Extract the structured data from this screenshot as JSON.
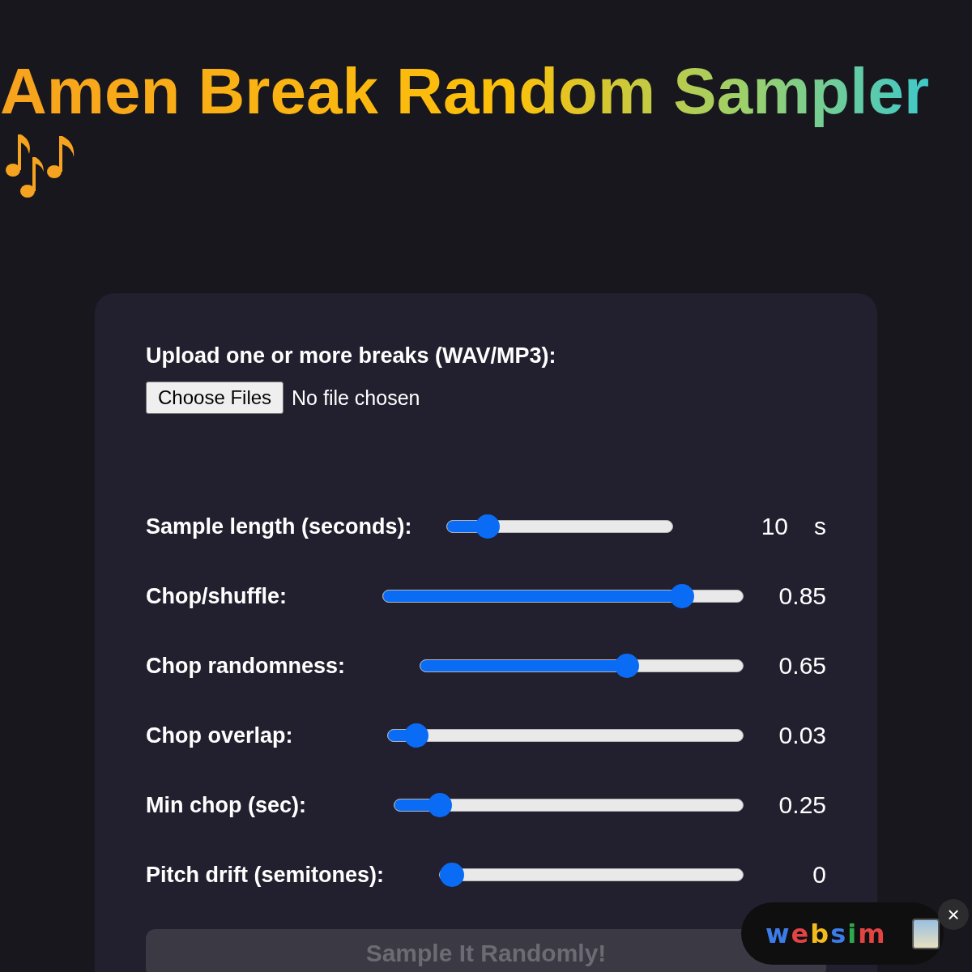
{
  "title": "Amen Break Random Sampler",
  "upload": {
    "label": "Upload one or more breaks (WAV/MP3):",
    "button": "Choose Files",
    "status": "No file chosen"
  },
  "sliders": [
    {
      "label": "Sample length (seconds):",
      "level": 0.18,
      "reading": "10",
      "unit": "s"
    },
    {
      "label": "Chop/shuffle:",
      "level": 0.83,
      "reading": "0.85"
    },
    {
      "label": "Chop randomness:",
      "level": 0.64,
      "reading": "0.65"
    },
    {
      "label": "Chop overlap:",
      "level": 0.08,
      "reading": "0.03"
    },
    {
      "label": "Min chop (sec):",
      "level": 0.13,
      "reading": "0.25"
    },
    {
      "label": "Pitch drift (semitones):",
      "level": 0.04,
      "reading": "0"
    }
  ],
  "action_button": {
    "label": "Sample It Randomly!",
    "disabled": true
  },
  "badge": {
    "label": "websim",
    "close": "×"
  }
}
